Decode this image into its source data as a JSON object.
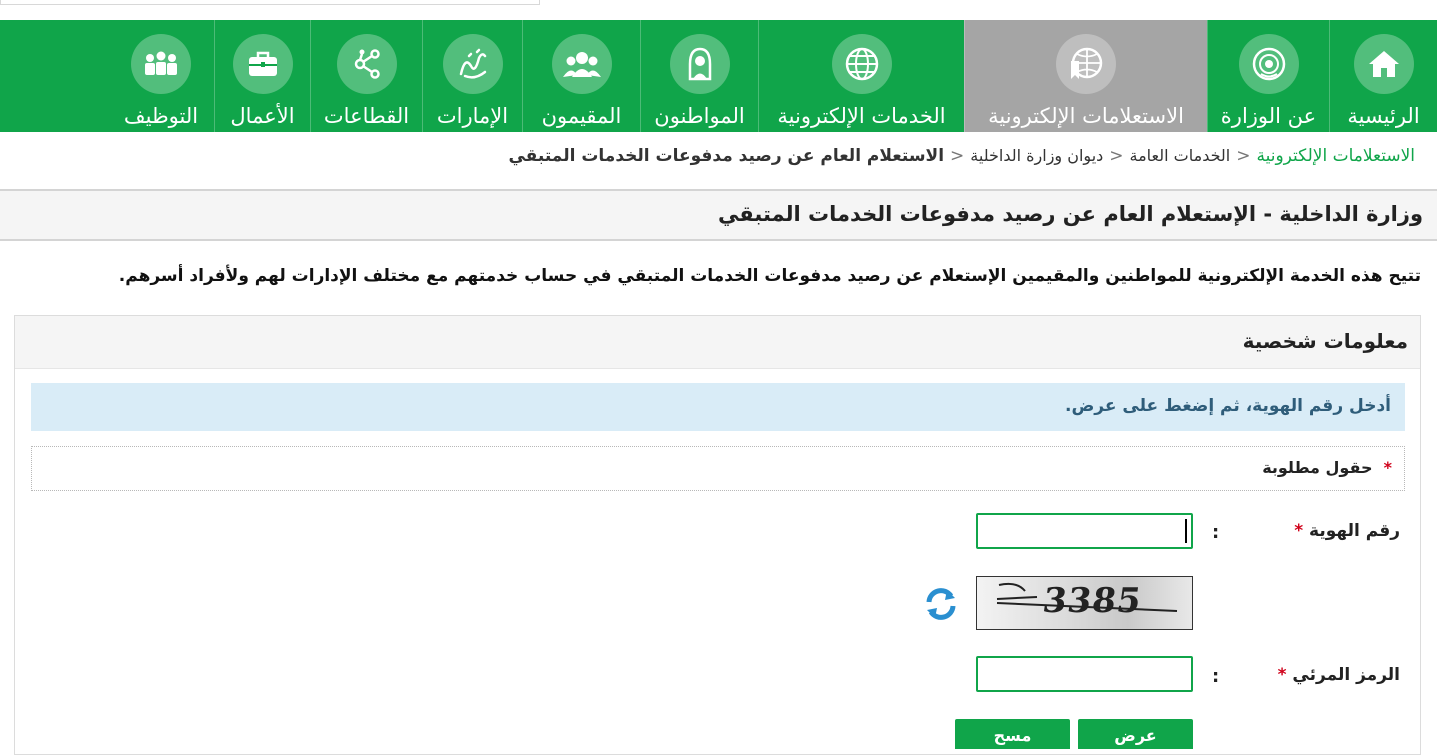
{
  "nav": {
    "items": [
      {
        "label": "الرئيسية",
        "icon": "home-icon"
      },
      {
        "label": "عن الوزارة",
        "icon": "ministry-emblem-icon"
      },
      {
        "label": "الاستعلامات الإلكترونية",
        "icon": "globe-inquiry-icon",
        "active": true
      },
      {
        "label": "الخدمات الإلكترونية",
        "icon": "globe-icon"
      },
      {
        "label": "المواطنون",
        "icon": "citizen-icon"
      },
      {
        "label": "المقيمون",
        "icon": "residents-group-icon"
      },
      {
        "label": "الإمارات",
        "icon": "emirates-calligraphy-icon"
      },
      {
        "label": "القطاعات",
        "icon": "sectors-network-icon"
      },
      {
        "label": "الأعمال",
        "icon": "briefcase-icon"
      },
      {
        "label": "التوظيف",
        "icon": "employment-people-icon"
      }
    ],
    "active_color": "#a5a5a5",
    "bar_color": "#10a54a"
  },
  "breadcrumb": {
    "items": [
      "الاستعلامات الإلكترونية",
      "الخدمات العامة",
      "ديوان وزارة الداخلية"
    ],
    "current": "الاستعلام العام عن رصيد مدفوعات الخدمات المتبقي",
    "separator": "<"
  },
  "page_title": "وزارة الداخلية - الإستعلام العام عن رصيد مدفوعات الخدمات المتبقي",
  "description": "تتيح هذه الخدمة الإلكترونية للمواطنين والمقيمين الإستعلام عن رصيد مدفوعات الخدمات المتبقي في حساب خدمتهم مع مختلف الإدارات لهم ولأفراد أسرهم.",
  "panel": {
    "title": "معلومات شخصية",
    "info": "أدخل رقم الهوية، ثم إضغط على عرض.",
    "required_note": "حقول مطلوبة",
    "required_star": "*"
  },
  "form": {
    "id_label": "رقم الهوية",
    "id_value": "",
    "captcha_label": "الرمز المرئي",
    "captcha_value": "",
    "captcha_image_text": "3385",
    "colon": ":",
    "star": "*"
  },
  "buttons": {
    "show": "عرض",
    "clear": "مسح"
  }
}
